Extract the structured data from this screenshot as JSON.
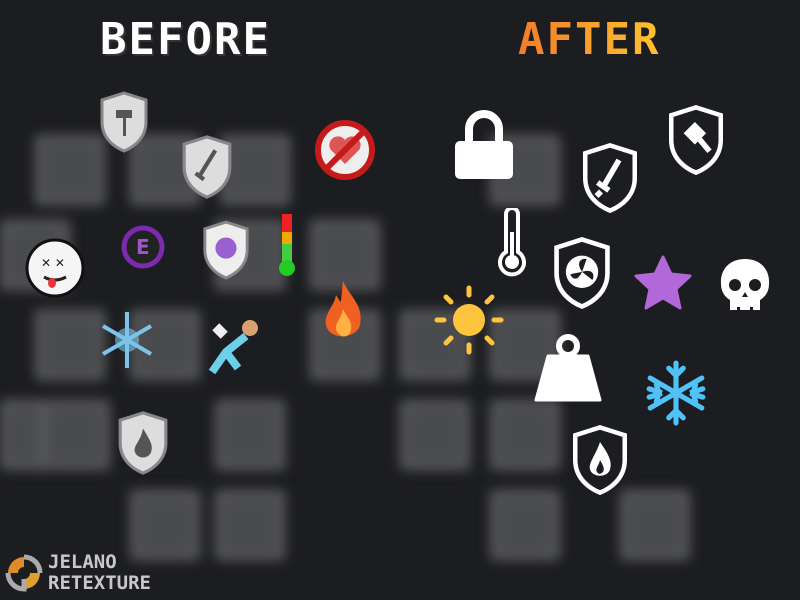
{
  "header": {
    "before_label": "BEFORE",
    "after_label": "AFTER"
  },
  "colors": {
    "after_gradient": [
      "#f27b2a",
      "#ffc22e"
    ],
    "background": "#1c1d20"
  },
  "before_icons": [
    "hammer-shield",
    "sword-shield",
    "no-heart",
    "dizzy-face",
    "e-circle",
    "purple-shield",
    "thermometer",
    "fire",
    "snowflake",
    "runner",
    "fire-shield"
  ],
  "after_icons": [
    "lock",
    "sword-shield",
    "hammer-shield",
    "thermometer",
    "fan-shield",
    "star",
    "skull",
    "sun",
    "weight",
    "snowflake",
    "fire-shield"
  ],
  "logo": {
    "line1": "JELANO",
    "line2": "RETEXTURE"
  }
}
